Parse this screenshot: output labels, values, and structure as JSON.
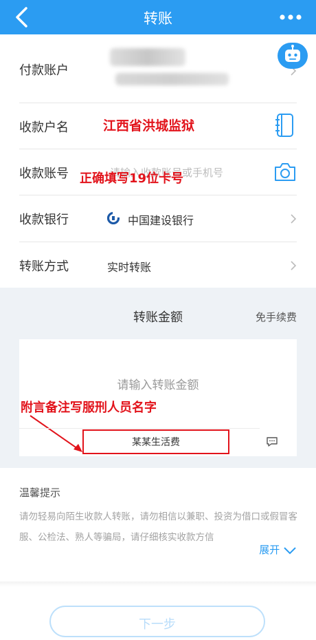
{
  "header": {
    "title": "转账",
    "back_icon": "back-chevron-icon",
    "more_icon": "more-dots-icon"
  },
  "form": {
    "payer": {
      "label": "付款账户"
    },
    "payee_name": {
      "label": "收款户名",
      "value": "江西省洪城监狱",
      "icon": "contact-book-icon"
    },
    "payee_account": {
      "label": "收款账号",
      "placeholder": "请输入收款账号或手机号",
      "annotation": "正确填写19位卡号",
      "icon": "camera-icon"
    },
    "bank": {
      "label": "收款银行",
      "value": "中国建设银行",
      "icon": "ccb-logo-icon"
    },
    "method": {
      "label": "转账方式",
      "value": "实时转账"
    }
  },
  "amount": {
    "title": "转账金额",
    "fee_note": "免手续费",
    "placeholder": "请输入转账金额",
    "annotation": "附言备注写服刑人员名字",
    "memo": "某某生活费"
  },
  "tips": {
    "title": "温馨提示",
    "text": "请勿轻易向陌生收款人转账，请勿相信以兼职、投资为借口或假冒客服、公检法、熟人等骗局，请仔细核实收款方信",
    "expand": "展开"
  },
  "next_button": "下一步",
  "colors": {
    "primary": "#2b9cf2",
    "annotation": "#e2131b",
    "background": "#eef2f6"
  }
}
